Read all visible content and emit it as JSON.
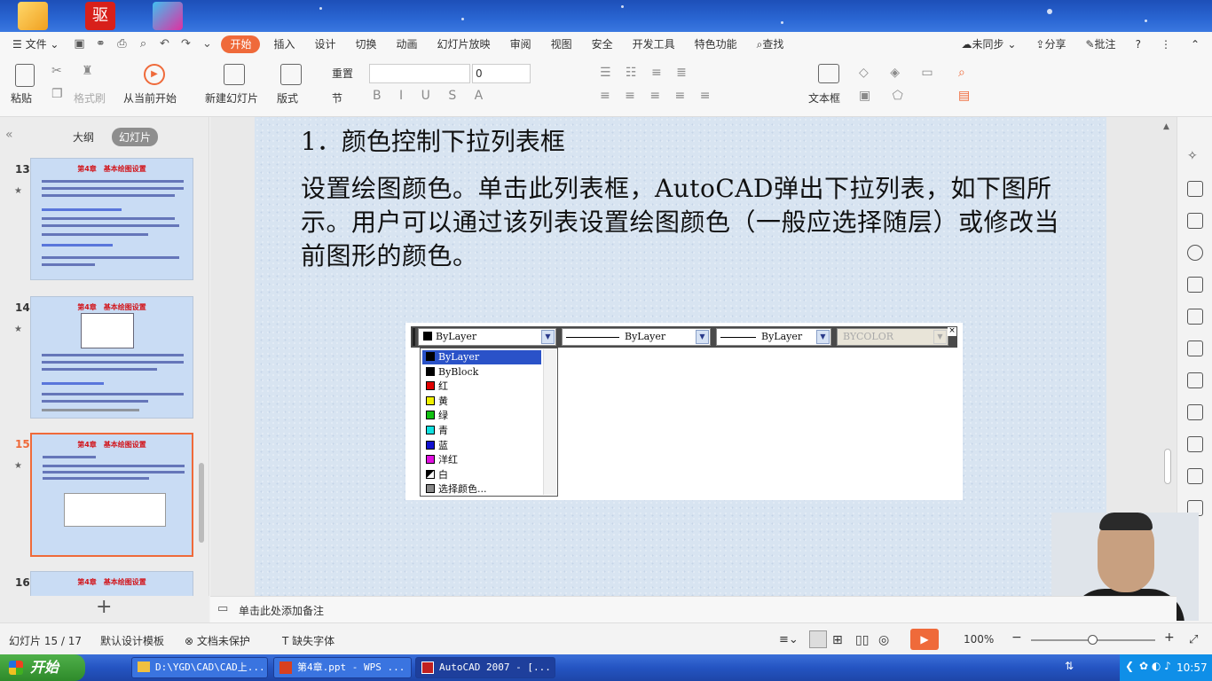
{
  "menu": {
    "file": "文件",
    "items": [
      "开始",
      "插入",
      "设计",
      "切换",
      "动画",
      "幻灯片放映",
      "审阅",
      "视图",
      "安全",
      "开发工具",
      "特色功能"
    ],
    "active": "开始",
    "search": "查找",
    "sync": "未同步",
    "share": "分享",
    "comment": "批注"
  },
  "ribbon": {
    "paste": "粘贴",
    "format_painter": "格式刷",
    "from_current": "从当前开始",
    "new_slide": "新建幻灯片",
    "layout": "版式",
    "reset": "重置",
    "section": "节",
    "font_size": "0",
    "textbox": "文本框"
  },
  "left_panel": {
    "tab_outline": "大纲",
    "tab_slides": "幻灯片",
    "slides": [
      {
        "num": "13",
        "title": "第4章　基本绘图设置"
      },
      {
        "num": "14",
        "title": "第4章　基本绘图设置"
      },
      {
        "num": "15",
        "title": "第4章　基本绘图设置"
      },
      {
        "num": "16",
        "title": "第4章　基本绘图设置"
      }
    ],
    "add": "+"
  },
  "slide": {
    "title": "1．颜色控制下拉列表框",
    "body": "设置绘图颜色。单击此列表框，AutoCAD弹出下拉列表，如下图所示。用户可以通过该列表设置绘图颜色（一般应选择随层）或修改当前图形的颜色。"
  },
  "acad": {
    "color_combo": "ByLayer",
    "linetype_combo": "ByLayer",
    "lineweight_combo": "ByLayer",
    "plot_combo": "BYCOLOR",
    "close": "×",
    "dropdown": [
      {
        "label": "ByLayer",
        "color": "#000000"
      },
      {
        "label": "ByBlock",
        "color": "#000000"
      },
      {
        "label": "红",
        "color": "#e00000"
      },
      {
        "label": "黄",
        "color": "#f0f000"
      },
      {
        "label": "绿",
        "color": "#10c010"
      },
      {
        "label": "青",
        "color": "#10e0e0"
      },
      {
        "label": "蓝",
        "color": "#1010d0"
      },
      {
        "label": "洋红",
        "color": "#e010e0"
      },
      {
        "label": "白",
        "color": "#ffffff"
      },
      {
        "label": "选择颜色...",
        "color": "#888888"
      }
    ],
    "selected": "ByLayer"
  },
  "notes": {
    "placeholder": "单击此处添加备注"
  },
  "status": {
    "slide_counter": "幻灯片 15 / 17",
    "template": "默认设计模板",
    "protect": "文档未保护",
    "missing_font": "缺失字体",
    "zoom": "100%"
  },
  "taskbar": {
    "start": "开始",
    "tasks": [
      "D:\\YGD\\CAD\\CAD上...",
      "第4章.ppt - WPS ...",
      "AutoCAD 2007 - [..."
    ],
    "time": "10:57"
  },
  "colors": {
    "accent": "#ef6a3a",
    "selected_blue": "#2a52c8"
  }
}
